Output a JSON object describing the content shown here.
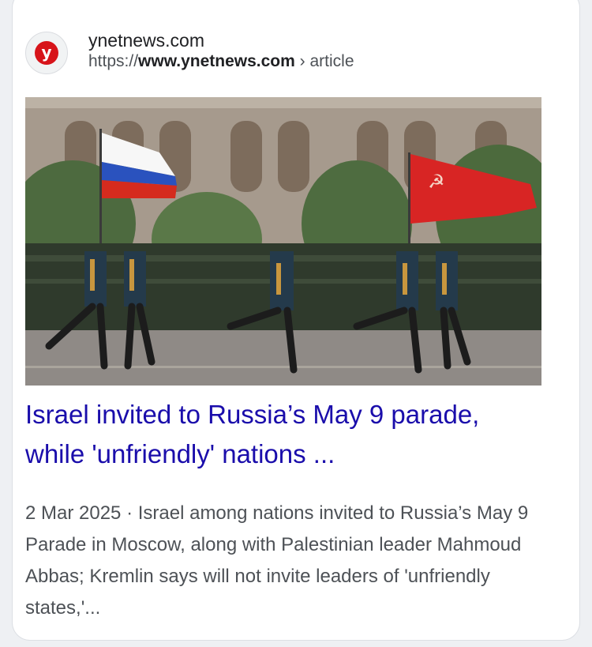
{
  "result": {
    "site_name": "ynetnews.com",
    "url_scheme": "https://",
    "url_domain": "www.ynetnews.com",
    "url_path": " › article",
    "favicon_letter": "y",
    "favicon_color": "#d7141a",
    "title": "Israel invited to Russia’s May 9 parade, while 'unfriendly' nations ...",
    "date": "2 Mar 2025",
    "separator": " · ",
    "snippet": "Israel among nations invited to Russia’s May 9 Parade in Moscow, along with Palestinian leader Mahmoud Abbas; Kremlin says will not invite leaders of 'unfriendly states,'...",
    "title_color": "#1a0dab"
  },
  "image": {
    "description_icon": "military-parade-photo"
  }
}
